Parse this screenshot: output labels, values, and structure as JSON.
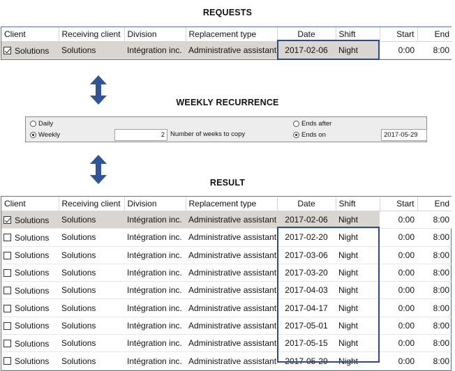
{
  "headings": {
    "requests": "REQUESTS",
    "weekly_recurrence": "WEEKLY RECURRENCE",
    "result": "RESULT"
  },
  "columns": [
    "Client",
    "Receiving client",
    "Division",
    "Replacement type",
    "Date",
    "Shift",
    "Start",
    "End"
  ],
  "requests": {
    "rows": [
      {
        "checked": true,
        "client": "Solutions",
        "receiving_client": "Solutions",
        "division": "Intégration inc.",
        "replacement_type": "Administrative assistant",
        "date": "2017-02-06",
        "shift": "Night",
        "start": "0:00",
        "end": "8:00"
      }
    ]
  },
  "recurrence": {
    "daily_label": "Daily",
    "weekly_label": "Weekly",
    "weeks_value": "2",
    "weeks_label": "Number of weeks to copy",
    "ends_after_label": "Ends after",
    "ends_on_label": "Ends on",
    "ends_on_value": "2017-05-29",
    "selected_frequency": "Weekly",
    "selected_end": "Ends on"
  },
  "result": {
    "rows": [
      {
        "checked": true,
        "client": "Solutions",
        "receiving_client": "Solutions",
        "division": "Intégration inc.",
        "replacement_type": "Administrative assistant",
        "date": "2017-02-06",
        "shift": "Night",
        "start": "0:00",
        "end": "8:00"
      },
      {
        "checked": false,
        "client": "Solutions",
        "receiving_client": "Solutions",
        "division": "Intégration inc.",
        "replacement_type": "Administrative assistant",
        "date": "2017-02-20",
        "shift": "Night",
        "start": "0:00",
        "end": "8:00"
      },
      {
        "checked": false,
        "client": "Solutions",
        "receiving_client": "Solutions",
        "division": "Intégration inc.",
        "replacement_type": "Administrative assistant",
        "date": "2017-03-06",
        "shift": "Night",
        "start": "0:00",
        "end": "8:00"
      },
      {
        "checked": false,
        "client": "Solutions",
        "receiving_client": "Solutions",
        "division": "Intégration inc.",
        "replacement_type": "Administrative assistant",
        "date": "2017-03-20",
        "shift": "Night",
        "start": "0:00",
        "end": "8:00"
      },
      {
        "checked": false,
        "client": "Solutions",
        "receiving_client": "Solutions",
        "division": "Intégration inc.",
        "replacement_type": "Administrative assistant",
        "date": "2017-04-03",
        "shift": "Night",
        "start": "0:00",
        "end": "8:00"
      },
      {
        "checked": false,
        "client": "Solutions",
        "receiving_client": "Solutions",
        "division": "Intégration inc.",
        "replacement_type": "Administrative assistant",
        "date": "2017-04-17",
        "shift": "Night",
        "start": "0:00",
        "end": "8:00"
      },
      {
        "checked": false,
        "client": "Solutions",
        "receiving_client": "Solutions",
        "division": "Intégration inc.",
        "replacement_type": "Administrative assistant",
        "date": "2017-05-01",
        "shift": "Night",
        "start": "0:00",
        "end": "8:00"
      },
      {
        "checked": false,
        "client": "Solutions",
        "receiving_client": "Solutions",
        "division": "Intégration inc.",
        "replacement_type": "Administrative assistant",
        "date": "2017-05-15",
        "shift": "Night",
        "start": "0:00",
        "end": "8:00"
      },
      {
        "checked": false,
        "client": "Solutions",
        "receiving_client": "Solutions",
        "division": "Intégration inc.",
        "replacement_type": "Administrative assistant",
        "date": "2017-05-29",
        "shift": "Night",
        "start": "0:00",
        "end": "8:00"
      }
    ]
  },
  "colors": {
    "highlight": "#2e4a82",
    "arrow": "#2f5597",
    "selected_row": "#d9d6d1",
    "panel_bg": "#ededed"
  },
  "icons": [
    "double-arrow-icon",
    "checkbox-icon",
    "radio-icon"
  ]
}
